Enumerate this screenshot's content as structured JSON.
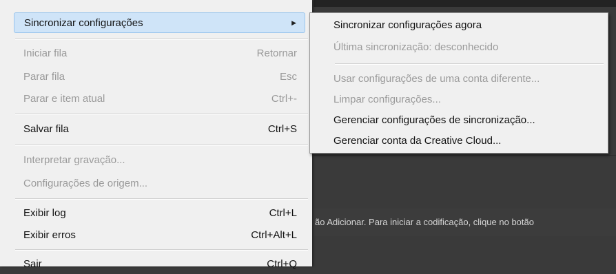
{
  "menu": {
    "items": [
      {
        "label": "Sincronizar configurações",
        "shortcut": "",
        "submenu_arrow": "▶"
      },
      {
        "label": "Iniciar fila",
        "shortcut": "Retornar"
      },
      {
        "label": "Parar fila",
        "shortcut": "Esc"
      },
      {
        "label": "Parar e item atual",
        "shortcut": "Ctrl+-"
      },
      {
        "label": "Salvar fila",
        "shortcut": "Ctrl+S"
      },
      {
        "label": "Interpretar gravação...",
        "shortcut": ""
      },
      {
        "label": "Configurações de origem...",
        "shortcut": ""
      },
      {
        "label": "Exibir log",
        "shortcut": "Ctrl+L"
      },
      {
        "label": "Exibir erros",
        "shortcut": "Ctrl+Alt+L"
      },
      {
        "label": "Sair",
        "shortcut": "Ctrl+Q"
      }
    ]
  },
  "submenu": {
    "items": [
      {
        "label": "Sincronizar configurações agora"
      },
      {
        "label": "Última sincronização: desconhecido"
      },
      {
        "label": "Usar configurações de uma conta diferente..."
      },
      {
        "label": "Limpar configurações..."
      },
      {
        "label": "Gerenciar configurações de sincronização..."
      },
      {
        "label": "Gerenciar conta da Creative Cloud..."
      }
    ]
  },
  "background": {
    "status_text": "ão Adicionar. Para iniciar a codificação, clique no botão"
  },
  "colors": {
    "menu_bg": "#f0f0f0",
    "highlight_bg": "#cfe4f8",
    "highlight_border": "#98c4ec",
    "disabled_text": "#9a9a9a",
    "app_bg": "#3a3a3a"
  }
}
